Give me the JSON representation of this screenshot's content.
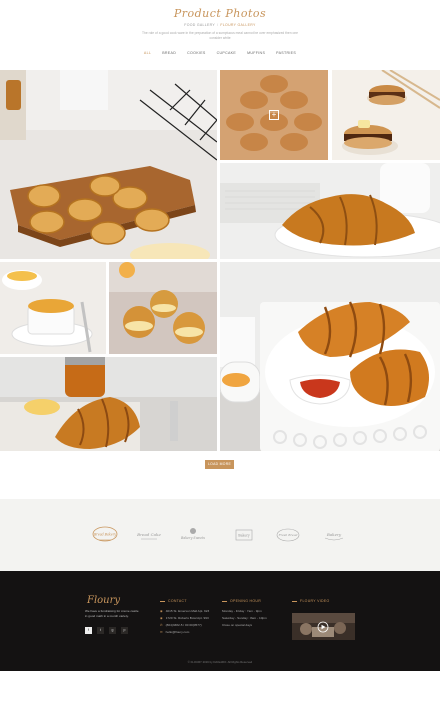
{
  "header": {
    "title": "Product Photos",
    "crumb_home": "FOOD GALLERY",
    "crumb_current": "FLOURY GALLERY",
    "intro": "The role of a good cook ware in the preparation of a sumptuous meal cannot be over emphasized then one consider white"
  },
  "filters": [
    "ALL",
    "BREAD",
    "COOKIES",
    "CUPCAKE",
    "MUFFINS",
    "PASTRIES"
  ],
  "gallery": {
    "overlay_icon": "plus-icon",
    "tiles": [
      {
        "name": "tile-egg-tarts",
        "alt": "egg tarts on cutting board"
      },
      {
        "name": "tile-muffins",
        "alt": "muffins (hover overlay)"
      },
      {
        "name": "tile-pancakes",
        "alt": "pancakes with butter"
      },
      {
        "name": "tile-croissant-newspaper",
        "alt": "croissant on plate"
      },
      {
        "name": "tile-creme-brulee",
        "alt": "creme brulee"
      },
      {
        "name": "tile-cream-puffs",
        "alt": "cream puffs"
      },
      {
        "name": "tile-croissants-jam",
        "alt": "croissants with jam"
      },
      {
        "name": "tile-croissant-honey",
        "alt": "croissant with honey"
      }
    ]
  },
  "load_more": "LOAD MORE",
  "logos": [
    "Bread Bakery",
    "Bread Cake",
    "Bakery Sweets",
    "Bakery",
    "Fresh Bread",
    "Bakery"
  ],
  "footer": {
    "brand": "Floury",
    "about": "We have a fundraising for creme castle in good math in a month variety.",
    "social": [
      "f",
      "t",
      "g",
      "p"
    ],
    "contact_title": "CONTACT",
    "contact": [
      "4015 St. Emerson Mall Apt. 923",
      "1720 St. Roberts Bowl Apt. 993",
      "(804)3382-5 / 00 00(0577)",
      "hello@floury.com"
    ],
    "hours_title": "OPENING HOUR",
    "hours": [
      "Monday - Friday : 7am - 9pm",
      "Saturday - Sunday : 8am - 10pm",
      "Close on special days"
    ],
    "video_title": "FLOURY VIDEO",
    "copyright": "© FLOURY 2016 by DAIGARO. All Rights Reserved"
  },
  "colors": {
    "accent": "#c8955c",
    "footer_bg": "#141212",
    "logos_bg": "#f3f3f1"
  }
}
